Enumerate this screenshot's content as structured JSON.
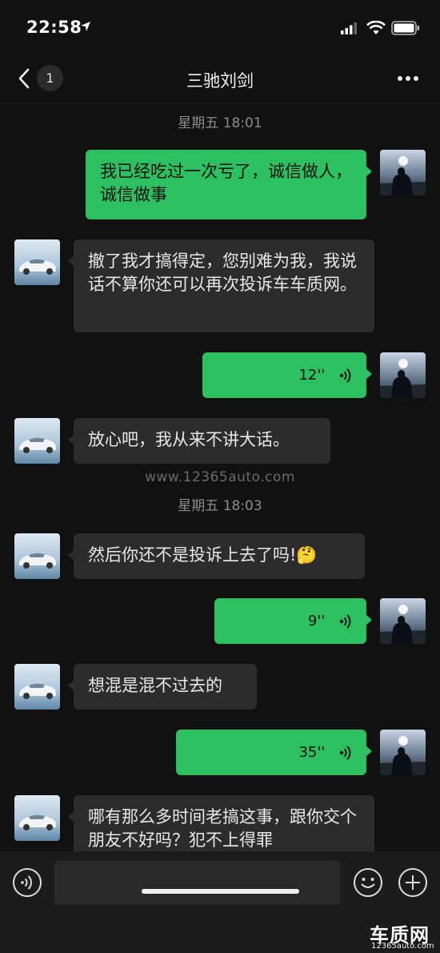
{
  "status_bar": {
    "time": "22:58"
  },
  "header": {
    "unread_count": "1",
    "title": "三驰刘剑"
  },
  "timestamps": {
    "first": "星期五 18:01",
    "second": "星期五 18:03"
  },
  "watermark": "www.12365auto.com",
  "messages": {
    "m1": {
      "text": "我已经吃过一次亏了，诚信做人，诚信做事"
    },
    "m2": {
      "text": "撤了我才搞得定，您别难为我，我说话不算你还可以再次投诉车车质网。"
    },
    "m3": {
      "duration": "12''"
    },
    "m4": {
      "text": "放心吧，我从来不讲大话。"
    },
    "m5": {
      "text": "然后你还不是投诉上去了吗!🤔"
    },
    "m6": {
      "duration": "9''"
    },
    "m7": {
      "text": "想混是混不过去的"
    },
    "m8": {
      "duration": "35''"
    },
    "m9": {
      "text": "哪有那么多时间老搞这事，跟你交个朋友不好吗？犯不上得罪"
    }
  },
  "logo_watermark": {
    "brand": "车质网",
    "url": "12365auto.com"
  },
  "colors": {
    "outgoing_bubble": "#2dc061",
    "incoming_bubble": "#2c2c2c",
    "background": "#111111"
  }
}
